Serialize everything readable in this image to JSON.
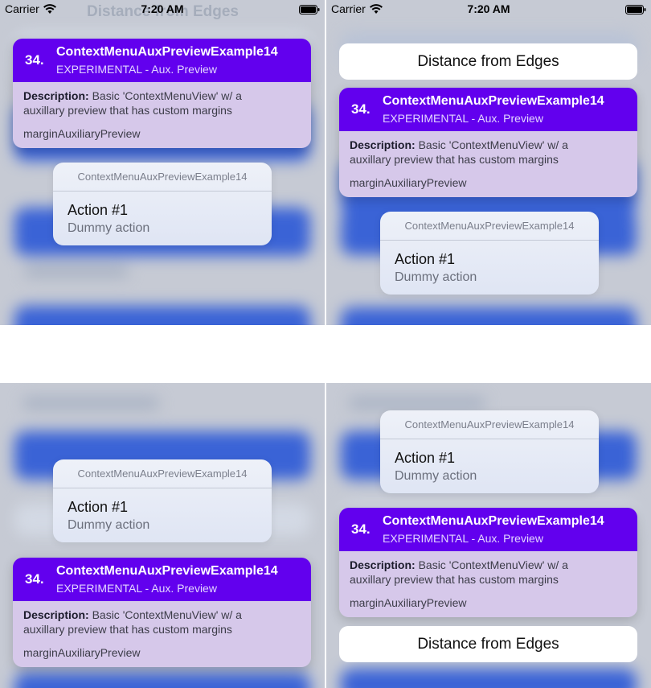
{
  "status_bar": {
    "carrier": "Carrier",
    "time": "7:20 AM"
  },
  "background": {
    "faded_title": "Distance from Edges"
  },
  "card": {
    "number": "34.",
    "title": "ContextMenuAuxPreviewExample14",
    "subtitle": "EXPERIMENTAL - Aux. Preview",
    "description_label": "Description:",
    "description_text": " Basic 'ContextMenuView' w/ a auxillary preview that has custom margins",
    "property": "marginAuxiliaryPreview"
  },
  "menu": {
    "title": "ContextMenuAuxPreviewExample14",
    "action_title": "Action #1",
    "action_subtitle": "Dummy action"
  },
  "aux_preview": {
    "label": "Distance from Edges"
  },
  "colors": {
    "card_header": "#6200ee",
    "card_body": "#d6c8ea",
    "backdrop_blue": "#3a63d6",
    "aux_preview": "#ffffff"
  }
}
